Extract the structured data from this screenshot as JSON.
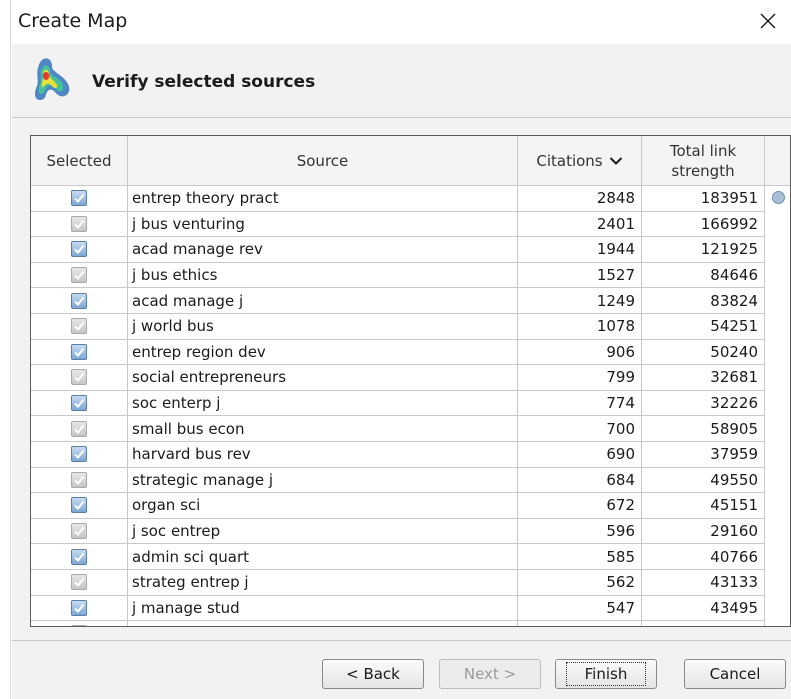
{
  "window": {
    "title": "Create Map"
  },
  "header": {
    "heading": "Verify selected sources"
  },
  "table": {
    "columns": {
      "selected": "Selected",
      "source": "Source",
      "citations": "Citations",
      "total_link_strength": "Total link strength"
    },
    "sort": {
      "column": "citations",
      "direction": "descending"
    },
    "rows": [
      {
        "selected": true,
        "source": "entrep theory pract",
        "citations": "2848",
        "tls": "183951"
      },
      {
        "selected": true,
        "source": "j bus venturing",
        "citations": "2401",
        "tls": "166992"
      },
      {
        "selected": true,
        "source": "acad manage rev",
        "citations": "1944",
        "tls": "121925"
      },
      {
        "selected": true,
        "source": "j bus ethics",
        "citations": "1527",
        "tls": "84646"
      },
      {
        "selected": true,
        "source": "acad manage j",
        "citations": "1249",
        "tls": "83824"
      },
      {
        "selected": true,
        "source": "j world bus",
        "citations": "1078",
        "tls": "54251"
      },
      {
        "selected": true,
        "source": "entrep region dev",
        "citations": "906",
        "tls": "50240"
      },
      {
        "selected": true,
        "source": "social entrepreneurs",
        "citations": "799",
        "tls": "32681"
      },
      {
        "selected": true,
        "source": "soc enterp j",
        "citations": "774",
        "tls": "32226"
      },
      {
        "selected": true,
        "source": "small bus econ",
        "citations": "700",
        "tls": "58905"
      },
      {
        "selected": true,
        "source": "harvard bus rev",
        "citations": "690",
        "tls": "37959"
      },
      {
        "selected": true,
        "source": "strategic manage j",
        "citations": "684",
        "tls": "49550"
      },
      {
        "selected": true,
        "source": "organ sci",
        "citations": "672",
        "tls": "45151"
      },
      {
        "selected": true,
        "source": "j soc entrep",
        "citations": "596",
        "tls": "29160"
      },
      {
        "selected": true,
        "source": "admin sci quart",
        "citations": "585",
        "tls": "40766"
      },
      {
        "selected": true,
        "source": "strateg entrep j",
        "citations": "562",
        "tls": "43133"
      },
      {
        "selected": true,
        "source": "j manage stud",
        "citations": "547",
        "tls": "43495"
      },
      {
        "selected": true,
        "source": "",
        "citations": "",
        "tls": ""
      }
    ]
  },
  "footer": {
    "back_label": "< Back",
    "next_label": "Next >",
    "finish_label": "Finish",
    "cancel_label": "Cancel",
    "next_enabled": false
  },
  "icons": {
    "close": "close-icon",
    "logo": "vosviewer-logo-icon",
    "sort": "chevron-down-icon",
    "checkbox": "checkbox-checked-icon"
  },
  "colors": {
    "header_bg": "#f2f2f2",
    "checkbox_blue": "#7ea6d3",
    "scroll_thumb": "#a9c0d8"
  }
}
